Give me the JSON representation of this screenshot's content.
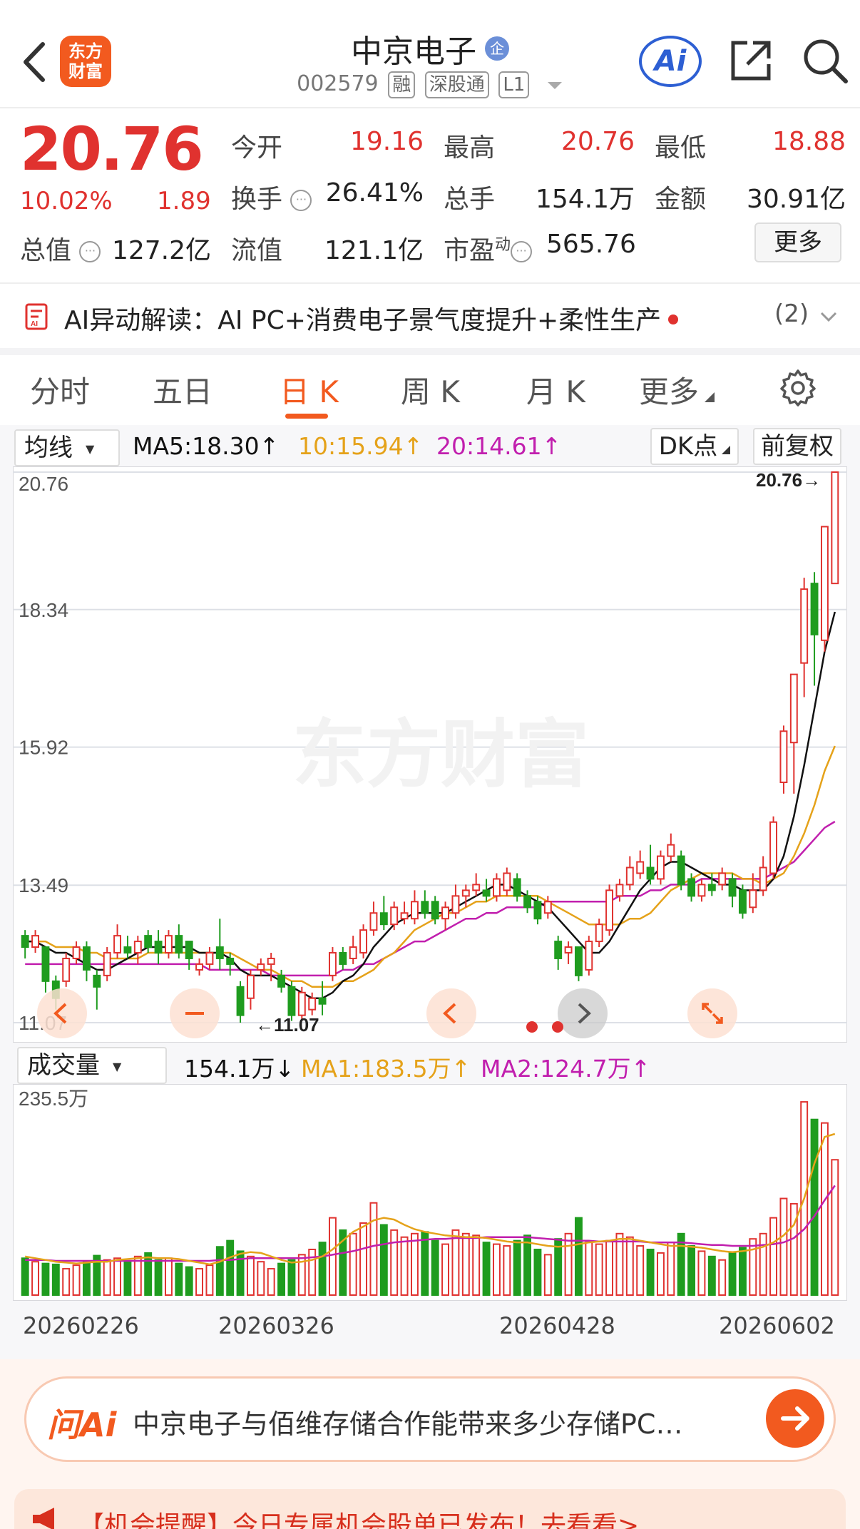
{
  "header": {
    "logo_line1": "东方",
    "logo_line2": "财富",
    "stock_name": "中京电子",
    "enterprise_badge": "企",
    "code": "002579",
    "tags": [
      "融",
      "深股通",
      "L1"
    ],
    "ai_label": "Ai"
  },
  "quote": {
    "price": "20.76",
    "change_pct": "10.02%",
    "change_amt": "1.89",
    "rows": [
      [
        {
          "label": "今开",
          "value": "19.16",
          "red": true
        },
        {
          "label": "最高",
          "value": "20.76",
          "red": true
        },
        {
          "label": "最低",
          "value": "18.88",
          "red": true
        }
      ],
      [
        {
          "label": "换手",
          "value": "26.41%",
          "red": false
        },
        {
          "label": "总手",
          "value": "154.1万",
          "red": false
        },
        {
          "label": "金额",
          "value": "30.91亿",
          "red": false
        }
      ]
    ],
    "total_value_label": "总值",
    "total_value": "127.2亿",
    "float_value_label": "流值",
    "float_value": "121.1亿",
    "pe_label": "市盈",
    "pe_sup": "动",
    "pe_value": "565.76",
    "more_label": "更多"
  },
  "ai_insight": {
    "text": "AI异动解读：AI PC+消费电子景气度提升+柔性生产",
    "count": "(2)"
  },
  "tabs": [
    {
      "label": "分时",
      "active": false
    },
    {
      "label": "五日",
      "active": false
    },
    {
      "label": "日 K",
      "active": true
    },
    {
      "label": "周 K",
      "active": false
    },
    {
      "label": "月 K",
      "active": false
    },
    {
      "label": "更多",
      "active": false
    }
  ],
  "kline": {
    "indicator_select": "均线",
    "ma5": "MA5:18.30↑",
    "ma10": "10:15.94↑",
    "ma20": "20:14.61↑",
    "dk_label": "DK点",
    "adjust_label": "前复权",
    "price_labels": [
      "20.76",
      "18.34",
      "15.92",
      "13.49",
      "11.07"
    ],
    "max_tag": "20.76→",
    "min_tag": "←11.07",
    "watermark": "东方财富"
  },
  "volume": {
    "indicator_select": "成交量",
    "vol": "154.1万↓",
    "ma1": "MA1:183.5万↑",
    "ma2": "MA2:124.7万↑",
    "max_label": "235.5万",
    "dates": [
      "20260226",
      "20260326",
      "20260428",
      "20260602"
    ]
  },
  "bottom": {
    "ask_logo": "问Ai",
    "ask_text": "中京电子与佰维存储合作能带来多少存储PC…",
    "promo_text": "【机会提醒】今日专属机会股单已发布！去看看>"
  },
  "colors": {
    "up": "#e0322f",
    "down": "#1f9c1f",
    "ma5": "#111111",
    "ma10": "#e5a21a",
    "ma20": "#c11fae",
    "accent": "#f25a1f"
  },
  "chart_data": {
    "type": "candlestick",
    "title": "",
    "price_range": [
      11.07,
      20.76
    ],
    "candles": [
      [
        12.6,
        12.4,
        12.7,
        12.2
      ],
      [
        12.4,
        12.6,
        12.7,
        12.3
      ],
      [
        12.4,
        11.8,
        12.4,
        11.6
      ],
      [
        11.8,
        11.5,
        11.9,
        11.3
      ],
      [
        11.8,
        12.2,
        12.3,
        11.7
      ],
      [
        12.2,
        12.4,
        12.5,
        12.1
      ],
      [
        12.4,
        12.0,
        12.5,
        11.8
      ],
      [
        11.9,
        11.7,
        12.0,
        11.3
      ],
      [
        11.9,
        12.3,
        12.4,
        11.8
      ],
      [
        12.3,
        12.6,
        12.8,
        12.2
      ],
      [
        12.4,
        12.3,
        12.6,
        12.2
      ],
      [
        12.3,
        12.5,
        12.6,
        12.1
      ],
      [
        12.6,
        12.4,
        12.7,
        12.3
      ],
      [
        12.5,
        12.3,
        12.7,
        12.1
      ],
      [
        12.3,
        12.6,
        12.7,
        12.2
      ],
      [
        12.6,
        12.3,
        12.8,
        12.2
      ],
      [
        12.5,
        12.2,
        12.5,
        12.0
      ],
      [
        12.0,
        12.1,
        12.2,
        11.9
      ],
      [
        12.1,
        12.3,
        12.4,
        12.0
      ],
      [
        12.4,
        12.2,
        12.9,
        12.0
      ],
      [
        12.2,
        12.1,
        12.3,
        11.9
      ],
      [
        11.7,
        11.2,
        11.8,
        11.07
      ],
      [
        11.5,
        11.9,
        12.0,
        11.3
      ],
      [
        12.0,
        12.1,
        12.2,
        11.9
      ],
      [
        12.1,
        12.2,
        12.3,
        11.8
      ],
      [
        11.9,
        11.7,
        12.0,
        11.6
      ],
      [
        11.7,
        11.2,
        11.8,
        11.1
      ],
      [
        11.2,
        11.6,
        11.7,
        11.1
      ],
      [
        11.3,
        11.5,
        11.6,
        11.2
      ],
      [
        11.5,
        11.4,
        11.8,
        11.2
      ],
      [
        11.9,
        12.3,
        12.4,
        11.8
      ],
      [
        12.3,
        12.1,
        12.4,
        12.0
      ],
      [
        12.2,
        12.4,
        12.6,
        12.1
      ],
      [
        12.3,
        12.7,
        12.8,
        12.2
      ],
      [
        12.7,
        13.0,
        13.2,
        12.6
      ],
      [
        13.0,
        12.8,
        13.3,
        12.7
      ],
      [
        12.8,
        13.1,
        13.2,
        12.7
      ],
      [
        12.9,
        13.0,
        13.2,
        12.8
      ],
      [
        12.9,
        13.2,
        13.4,
        12.8
      ],
      [
        13.2,
        13.0,
        13.4,
        12.9
      ],
      [
        13.2,
        12.9,
        13.3,
        12.8
      ],
      [
        12.9,
        13.1,
        13.2,
        12.7
      ],
      [
        13.0,
        13.3,
        13.5,
        12.9
      ],
      [
        13.3,
        13.4,
        13.5,
        13.1
      ],
      [
        13.4,
        13.5,
        13.7,
        13.3
      ],
      [
        13.4,
        13.3,
        13.6,
        13.2
      ],
      [
        13.3,
        13.6,
        13.7,
        13.2
      ],
      [
        13.4,
        13.7,
        13.8,
        13.3
      ],
      [
        13.6,
        13.3,
        13.7,
        13.2
      ],
      [
        13.3,
        13.1,
        13.4,
        13.0
      ],
      [
        13.2,
        12.9,
        13.3,
        12.8
      ],
      [
        13.0,
        13.2,
        13.3,
        12.9
      ],
      [
        12.5,
        12.2,
        12.6,
        12.0
      ],
      [
        12.3,
        12.4,
        12.5,
        12.1
      ],
      [
        12.4,
        11.9,
        12.4,
        11.8
      ],
      [
        12.0,
        12.5,
        12.6,
        11.9
      ],
      [
        12.5,
        12.8,
        12.9,
        12.4
      ],
      [
        12.7,
        13.4,
        13.5,
        12.6
      ],
      [
        13.3,
        13.5,
        13.6,
        13.2
      ],
      [
        13.5,
        13.8,
        14.0,
        13.4
      ],
      [
        13.7,
        13.9,
        14.1,
        13.6
      ],
      [
        13.8,
        13.6,
        14.2,
        13.5
      ],
      [
        13.6,
        14.0,
        14.1,
        13.5
      ],
      [
        14.0,
        14.2,
        14.4,
        13.9
      ],
      [
        14.0,
        13.5,
        14.1,
        13.4
      ],
      [
        13.6,
        13.3,
        13.7,
        13.2
      ],
      [
        13.3,
        13.5,
        13.6,
        13.2
      ],
      [
        13.5,
        13.4,
        13.7,
        13.3
      ],
      [
        13.5,
        13.7,
        13.8,
        13.4
      ],
      [
        13.6,
        13.3,
        13.7,
        13.1
      ],
      [
        13.4,
        13.0,
        13.5,
        12.9
      ],
      [
        13.1,
        13.4,
        13.7,
        13.0
      ],
      [
        13.4,
        13.8,
        14.0,
        13.3
      ],
      [
        13.7,
        14.6,
        14.7,
        13.6
      ],
      [
        15.3,
        16.2,
        16.3,
        15.1
      ],
      [
        16.0,
        17.2,
        17.2,
        15.1
      ],
      [
        17.4,
        18.7,
        18.9,
        16.8
      ],
      [
        18.8,
        17.9,
        19.0,
        17.0
      ],
      [
        17.8,
        19.8,
        19.4,
        17.6
      ],
      [
        18.8,
        20.76,
        20.76,
        18.88
      ]
    ],
    "ma5": [
      12.5,
      12.5,
      12.4,
      12.3,
      12.3,
      12.2,
      12.1,
      12.0,
      12.0,
      12.1,
      12.2,
      12.3,
      12.4,
      12.4,
      12.4,
      12.4,
      12.4,
      12.3,
      12.3,
      12.3,
      12.2,
      12.0,
      11.9,
      11.9,
      11.9,
      11.8,
      11.7,
      11.6,
      11.5,
      11.5,
      11.6,
      11.8,
      11.9,
      12.1,
      12.4,
      12.6,
      12.8,
      12.9,
      13.0,
      13.0,
      13.0,
      13.0,
      13.1,
      13.2,
      13.3,
      13.4,
      13.5,
      13.5,
      13.4,
      13.3,
      13.2,
      13.1,
      12.9,
      12.7,
      12.5,
      12.3,
      12.3,
      12.5,
      12.8,
      13.1,
      13.4,
      13.6,
      13.8,
      13.9,
      13.9,
      13.8,
      13.7,
      13.6,
      13.5,
      13.5,
      13.4,
      13.4,
      13.4,
      13.6,
      14.0,
      14.7,
      15.6,
      16.6,
      17.6,
      18.3
    ],
    "ma10": [
      12.5,
      12.5,
      12.5,
      12.4,
      12.4,
      12.4,
      12.3,
      12.3,
      12.2,
      12.2,
      12.2,
      12.2,
      12.3,
      12.3,
      12.3,
      12.3,
      12.3,
      12.3,
      12.3,
      12.3,
      12.3,
      12.2,
      12.1,
      12.0,
      12.0,
      11.9,
      11.8,
      11.8,
      11.7,
      11.7,
      11.7,
      11.8,
      11.8,
      11.9,
      12.0,
      12.2,
      12.3,
      12.5,
      12.7,
      12.8,
      12.9,
      13.0,
      13.0,
      13.1,
      13.2,
      13.2,
      13.3,
      13.3,
      13.3,
      13.3,
      13.3,
      13.2,
      13.1,
      13.0,
      12.9,
      12.8,
      12.8,
      12.8,
      12.8,
      12.9,
      12.9,
      13.0,
      13.2,
      13.4,
      13.5,
      13.6,
      13.7,
      13.7,
      13.7,
      13.7,
      13.6,
      13.6,
      13.5,
      13.6,
      13.7,
      14.0,
      14.4,
      14.9,
      15.5,
      15.94
    ],
    "ma20": [
      12.1,
      12.1,
      12.1,
      12.1,
      12.1,
      12.1,
      12.1,
      12.1,
      12.1,
      12.1,
      12.1,
      12.1,
      12.1,
      12.1,
      12.1,
      12.1,
      12.1,
      12.1,
      12.0,
      12.0,
      12.0,
      12.0,
      12.0,
      12.0,
      11.9,
      11.9,
      11.9,
      11.9,
      11.9,
      11.9,
      11.9,
      12.0,
      12.0,
      12.1,
      12.1,
      12.2,
      12.3,
      12.4,
      12.5,
      12.5,
      12.6,
      12.7,
      12.8,
      12.9,
      12.9,
      13.0,
      13.0,
      13.1,
      13.1,
      13.1,
      13.1,
      13.2,
      13.2,
      13.2,
      13.2,
      13.2,
      13.2,
      13.2,
      13.3,
      13.3,
      13.3,
      13.4,
      13.4,
      13.5,
      13.5,
      13.5,
      13.6,
      13.6,
      13.6,
      13.6,
      13.6,
      13.6,
      13.6,
      13.7,
      13.8,
      13.9,
      14.1,
      14.3,
      14.5,
      14.61
    ],
    "volume_max": 235.5,
    "volumes": [
      42,
      38,
      36,
      35,
      30,
      34,
      38,
      45,
      40,
      42,
      38,
      44,
      48,
      40,
      42,
      36,
      32,
      30,
      34,
      55,
      62,
      50,
      44,
      38,
      30,
      36,
      40,
      46,
      52,
      60,
      88,
      74,
      70,
      82,
      105,
      80,
      74,
      66,
      70,
      72,
      62,
      58,
      74,
      70,
      68,
      60,
      58,
      56,
      62,
      68,
      52,
      46,
      64,
      70,
      88,
      60,
      58,
      62,
      70,
      66,
      56,
      52,
      48,
      60,
      70,
      56,
      50,
      44,
      40,
      48,
      54,
      64,
      70,
      88,
      110,
      104,
      220,
      200,
      196,
      154.1
    ],
    "vol_ma1": [
      44,
      42,
      40,
      38,
      37,
      36,
      37,
      38,
      38,
      40,
      41,
      42,
      43,
      42,
      42,
      41,
      39,
      37,
      35,
      38,
      43,
      47,
      49,
      48,
      44,
      40,
      37,
      38,
      40,
      44,
      52,
      62,
      72,
      78,
      85,
      88,
      86,
      80,
      75,
      72,
      70,
      68,
      67,
      66,
      66,
      65,
      63,
      61,
      60,
      60,
      58,
      56,
      55,
      56,
      58,
      60,
      61,
      62,
      64,
      64,
      62,
      60,
      58,
      56,
      56,
      55,
      54,
      52,
      50,
      49,
      50,
      52,
      55,
      60,
      68,
      80,
      110,
      150,
      180,
      183.5
    ],
    "vol_ma2": [
      40,
      40,
      40,
      39,
      39,
      39,
      39,
      39,
      39,
      39,
      39,
      39,
      39,
      39,
      39,
      39,
      39,
      39,
      39,
      40,
      40,
      41,
      42,
      42,
      42,
      42,
      42,
      42,
      43,
      44,
      46,
      48,
      50,
      53,
      56,
      58,
      60,
      61,
      62,
      63,
      64,
      64,
      65,
      65,
      65,
      66,
      66,
      66,
      66,
      66,
      65,
      64,
      63,
      62,
      62,
      62,
      61,
      61,
      61,
      61,
      61,
      60,
      60,
      60,
      60,
      59,
      58,
      57,
      57,
      56,
      56,
      56,
      57,
      58,
      60,
      65,
      75,
      90,
      108,
      124.7
    ]
  }
}
